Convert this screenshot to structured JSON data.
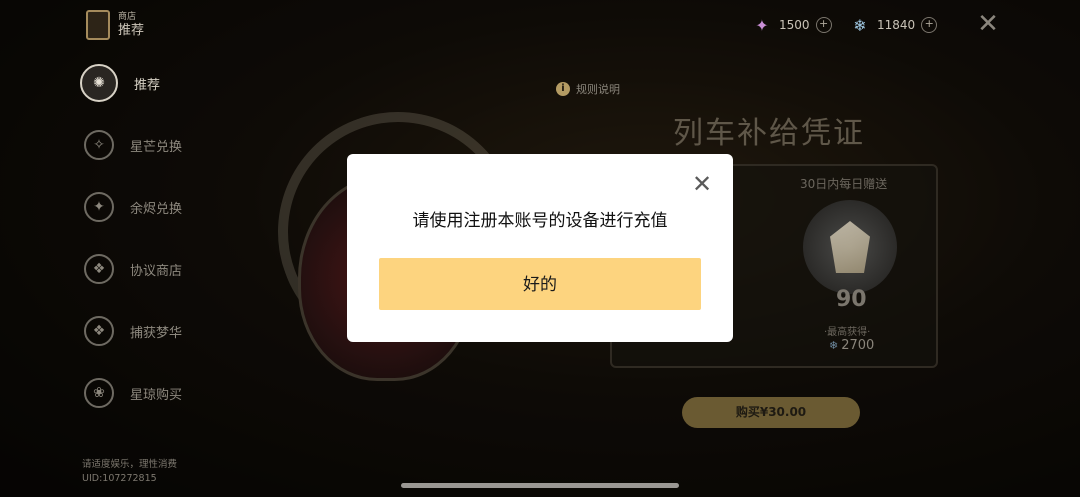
{
  "sidebar": {
    "shop": {
      "label": "商店",
      "sub": "推荐"
    },
    "items": [
      {
        "label": "推荐",
        "icon": "recommend-icon",
        "glyph": "✺"
      },
      {
        "label": "星芒兑换",
        "icon": "starlight-icon",
        "glyph": "✧"
      },
      {
        "label": "余烬兑换",
        "icon": "embers-icon",
        "glyph": "✦"
      },
      {
        "label": "协议商店",
        "icon": "protocol-icon",
        "glyph": "❖"
      },
      {
        "label": "捕获梦华",
        "icon": "dream-icon",
        "glyph": "❖"
      },
      {
        "label": "星琼购买",
        "icon": "jade-icon",
        "glyph": "❀"
      }
    ],
    "footer": {
      "line1": "请适度娱乐，理性消费",
      "line2": "UID:107272815"
    }
  },
  "topbar": {
    "currency1": {
      "value": "1500",
      "icon": "stellar-jade-icon",
      "glyph": "✦"
    },
    "currency2": {
      "value": "11840",
      "icon": "oneiric-shard-icon",
      "glyph": "❄"
    },
    "plus": "+",
    "close": "✕"
  },
  "content": {
    "rules": "规则说明",
    "rules_icon": "i",
    "title": "列车补给凭证",
    "card": {
      "head": "30日内每日赠送",
      "amount": "90",
      "max_label": "·最高获得·",
      "max_value": "2700",
      "max_icon": "❄"
    },
    "buy": "购买¥30.00"
  },
  "modal": {
    "close": "✕",
    "message": "请使用注册本账号的设备进行充值",
    "ok": "好的"
  }
}
